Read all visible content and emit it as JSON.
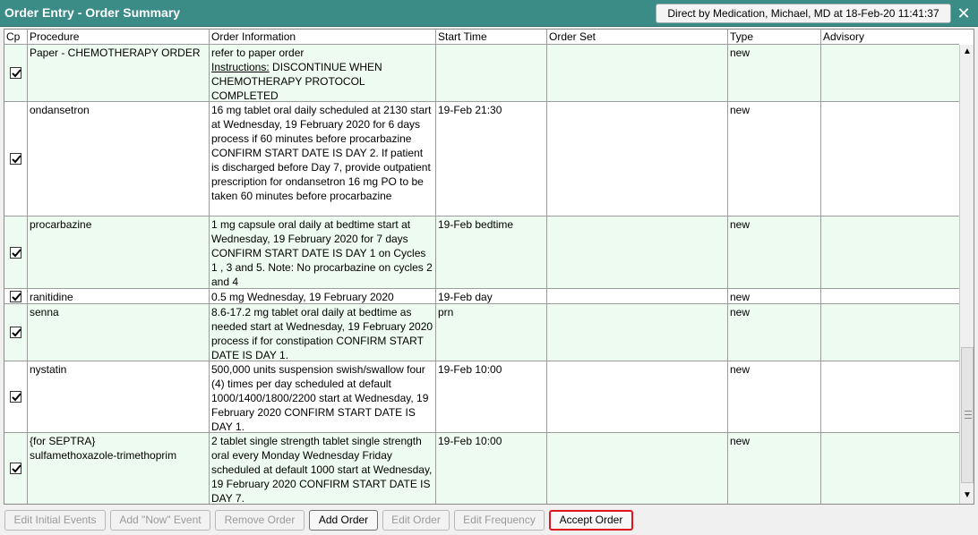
{
  "window": {
    "title": "Order Entry - Order Summary",
    "encounter": "Direct by Medication, Michael, MD at 18-Feb-20 11:41:37",
    "close_glyph": "✕"
  },
  "columns": [
    "Cp",
    "Procedure",
    "Order Information",
    "Start Time",
    "Order Set",
    "Type",
    "Advisory"
  ],
  "orders": [
    {
      "checked": true,
      "procedure": "Paper - CHEMOTHERAPY ORDER",
      "procedure_line2": "",
      "info": "refer to paper order",
      "info_label": "Instructions:",
      "info_extra": " DISCONTINUE WHEN CHEMOTHERAPY PROTOCOL COMPLETED",
      "start": "",
      "order_set": "",
      "type": "new",
      "advisory": ""
    },
    {
      "checked": true,
      "procedure": "ondansetron",
      "procedure_line2": "",
      "info": "16 mg tablet oral daily scheduled at 2130 start at Wednesday, 19 February 2020 for 6 days process if 60 minutes before procarbazine CONFIRM START DATE IS DAY 2. If patient is discharged before Day 7, provide outpatient prescription for ondansetron 16 mg PO to be taken 60 minutes before procarbazine",
      "info_label": "",
      "info_extra": "",
      "start": "19-Feb 21:30",
      "order_set": "",
      "type": "new",
      "advisory": ""
    },
    {
      "checked": true,
      "procedure": "procarbazine",
      "procedure_line2": "",
      "info": "1 mg capsule oral daily at bedtime start at Wednesday, 19 February 2020 for 7 days CONFIRM START DATE IS DAY 1 on Cycles 1 , 3 and 5. Note: No procarbazine on cycles 2 and 4",
      "info_label": "",
      "info_extra": "",
      "start": "19-Feb bedtime",
      "order_set": "",
      "type": "new",
      "advisory": ""
    },
    {
      "checked": true,
      "procedure": "ranitidine",
      "procedure_line2": "",
      "info": "0.5 mg Wednesday, 19 February 2020",
      "info_label": "",
      "info_extra": "",
      "start": "19-Feb day",
      "order_set": "",
      "type": "new",
      "advisory": ""
    },
    {
      "checked": true,
      "procedure": "senna",
      "procedure_line2": "",
      "info": "8.6-17.2 mg tablet oral daily at bedtime as needed start at Wednesday, 19 February 2020 process if for constipation CONFIRM START DATE IS DAY 1.",
      "info_label": "",
      "info_extra": "",
      "start": "prn",
      "order_set": "",
      "type": "new",
      "advisory": ""
    },
    {
      "checked": true,
      "procedure": "nystatin",
      "procedure_line2": "",
      "info": "500,000 units suspension swish/swallow four (4) times per day scheduled at default 1000/1400/1800/2200 start at Wednesday, 19 February 2020 CONFIRM START DATE IS DAY 1.",
      "info_label": "",
      "info_extra": "",
      "start": "19-Feb 10:00",
      "order_set": "",
      "type": "new",
      "advisory": ""
    },
    {
      "checked": true,
      "procedure": "{for SEPTRA}",
      "procedure_line2": "sulfamethoxazole-trimethoprim",
      "info": "2 tablet single strength tablet single strength oral every Monday Wednesday Friday scheduled at default 1000 start at Wednesday, 19 February 2020 CONFIRM START DATE IS DAY 7.",
      "info_label": "",
      "info_extra": "",
      "start": "19-Feb 10:00",
      "order_set": "",
      "type": "new",
      "advisory": ""
    }
  ],
  "buttons": {
    "edit_initial_events": "Edit Initial Events",
    "add_now_event": "Add \"Now\" Event",
    "remove_order": "Remove Order",
    "add_order": "Add Order",
    "edit_order": "Edit Order",
    "edit_frequency": "Edit Frequency",
    "accept_order": "Accept Order"
  },
  "colors": {
    "title_bar": "#3b8c87",
    "row_tint": "#edfbf0",
    "accept_highlight": "#e0141e"
  }
}
